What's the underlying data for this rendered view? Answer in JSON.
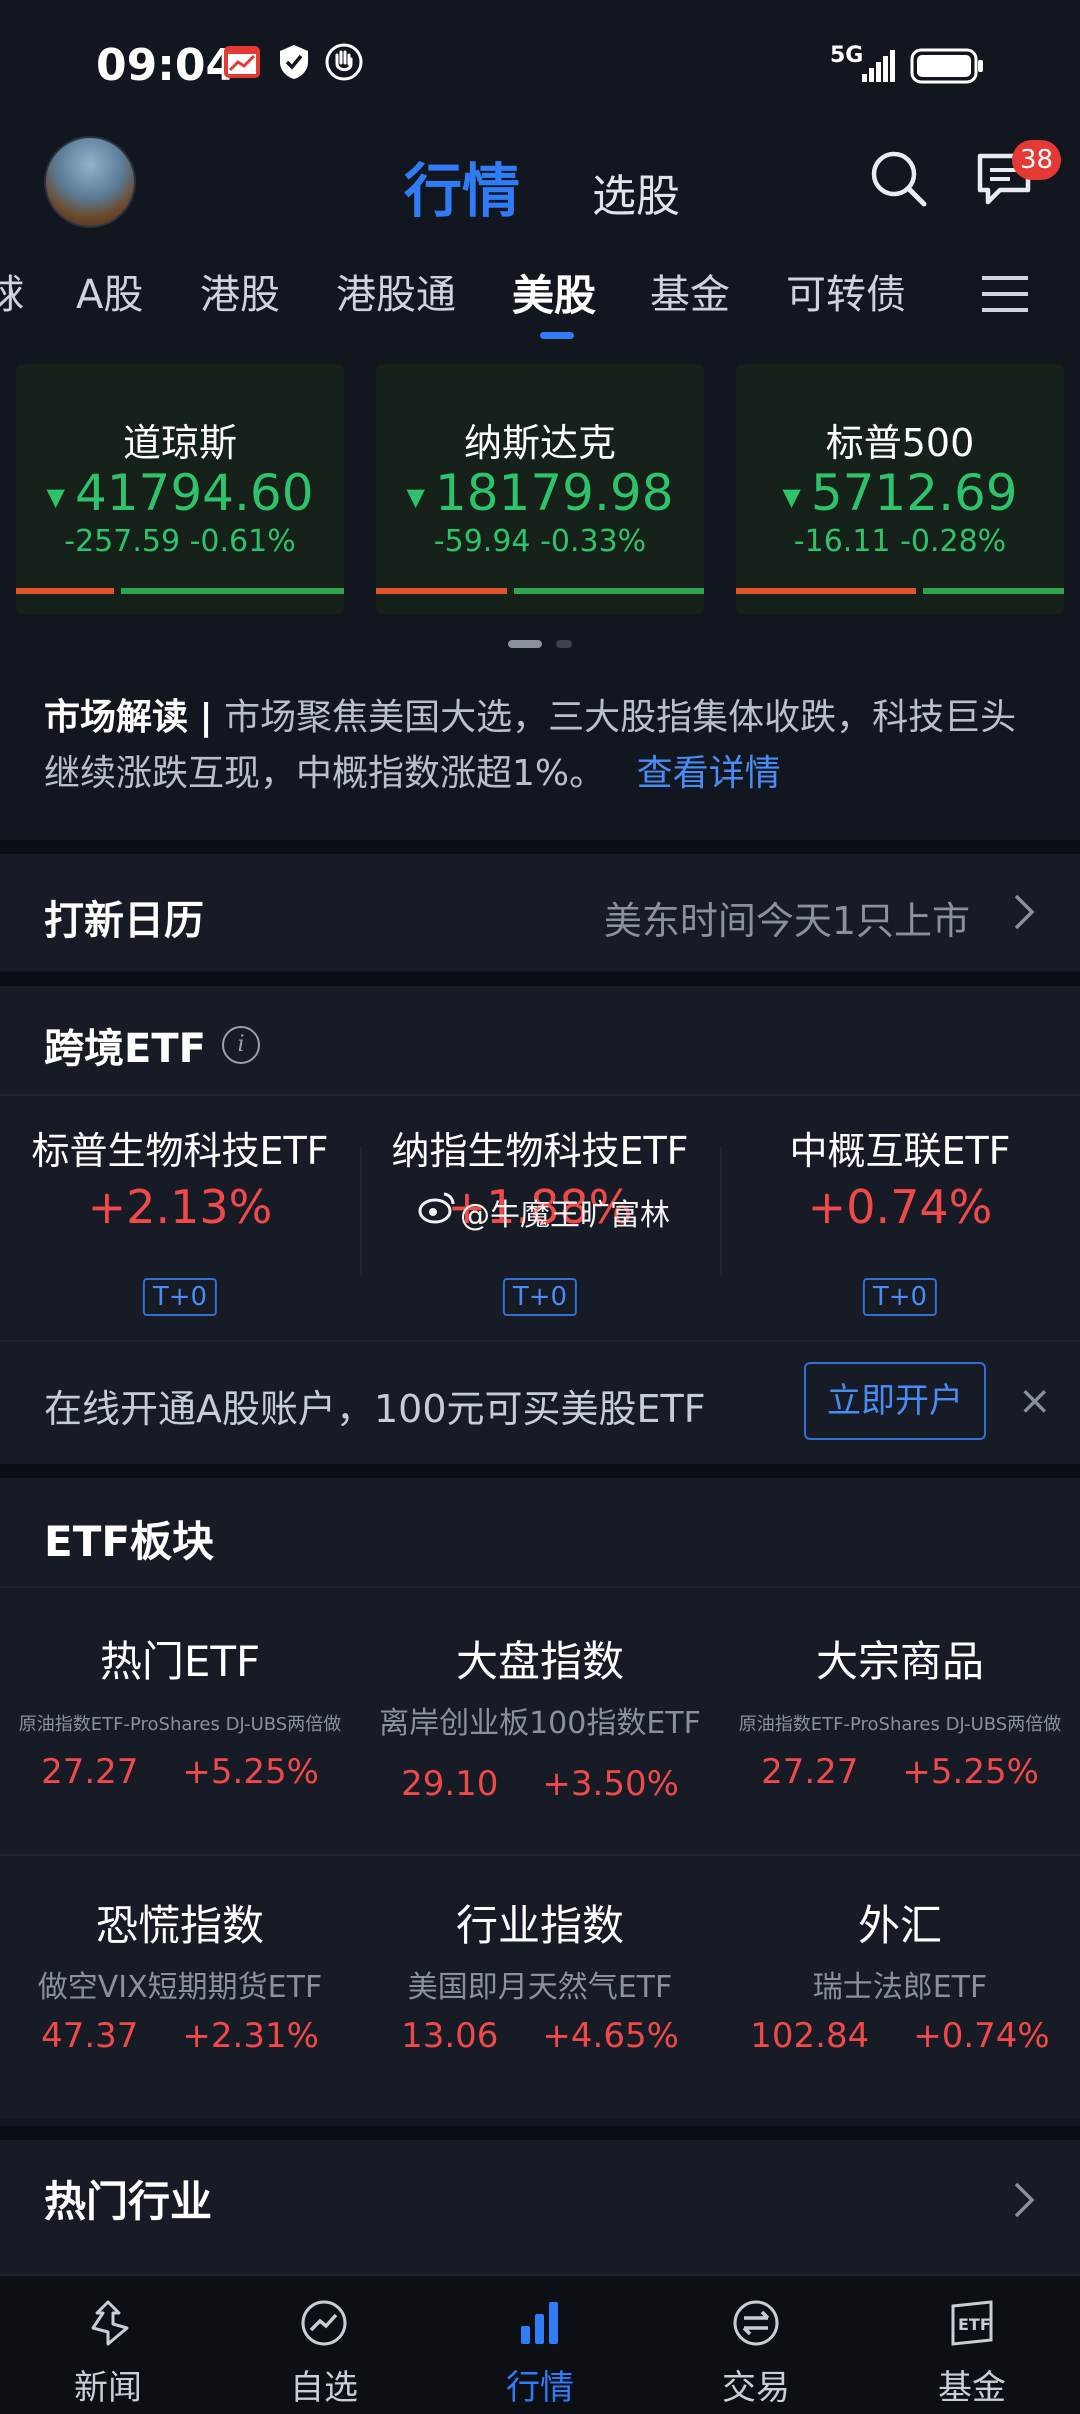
{
  "status_bar": {
    "time": "09:04",
    "network": "5G"
  },
  "header": {
    "title": "行情",
    "subtitle": "选股",
    "message_badge": "38"
  },
  "tabs": [
    "球",
    "A股",
    "港股",
    "港股通",
    "美股",
    "基金",
    "可转债"
  ],
  "active_tab": "美股",
  "indices": [
    {
      "name": "道琼斯",
      "value": "41794.60",
      "change": "-257.59",
      "percent": "-0.61%",
      "red_share": 0.3
    },
    {
      "name": "纳斯达克",
      "value": "18179.98",
      "change": "-59.94",
      "percent": "-0.33%",
      "red_share": 0.4
    },
    {
      "name": "标普500",
      "value": "5712.69",
      "change": "-16.11",
      "percent": "-0.28%",
      "red_share": 0.55
    }
  ],
  "market_read": {
    "label": "市场解读",
    "divider": "|",
    "text": "市场聚焦美国大选，三大股指集体收跌，科技巨头继续涨跌互现，中概指数涨超1%。",
    "link": "查看详情"
  },
  "ipo": {
    "title": "打新日历",
    "desc": "美东时间今天1只上市"
  },
  "cross_etf": {
    "title": "跨境ETF",
    "items": [
      {
        "name": "标普生物科技ETF",
        "pct": "+2.13%",
        "tag": "T+0"
      },
      {
        "name": "纳指生物科技ETF",
        "pct": "+1.88%",
        "tag": "T+0"
      },
      {
        "name": "中概互联ETF",
        "pct": "+0.74%",
        "tag": "T+0"
      }
    ]
  },
  "watermark": "@牛魔王旷富林",
  "promo": {
    "text": "在线开通A股账户，100元可买美股ETF",
    "button": "立即开户",
    "close": "×"
  },
  "sector": {
    "title": "ETF板块",
    "items": [
      {
        "name": "热门ETF",
        "desc": "原油指数ETF-ProShares DJ-UBS两倍做",
        "price": "27.27",
        "pct": "+5.25%"
      },
      {
        "name": "大盘指数",
        "desc": "离岸创业板100指数ETF",
        "price": "29.10",
        "pct": "+3.50%"
      },
      {
        "name": "大宗商品",
        "desc": "原油指数ETF-ProShares DJ-UBS两倍做",
        "price": "27.27",
        "pct": "+5.25%"
      },
      {
        "name": "恐慌指数",
        "desc": "做空VIX短期期货ETF",
        "price": "47.37",
        "pct": "+2.31%"
      },
      {
        "name": "行业指数",
        "desc": "美国即月天然气ETF",
        "price": "13.06",
        "pct": "+4.65%"
      },
      {
        "name": "外汇",
        "desc": "瑞士法郎ETF",
        "price": "102.84",
        "pct": "+0.74%"
      }
    ]
  },
  "hot_industry": {
    "title": "热门行业"
  },
  "bottom_nav": [
    "新闻",
    "自选",
    "行情",
    "交易",
    "基金"
  ],
  "colors": {
    "accent": "#2f7cf6",
    "up": "#f0494a",
    "down": "#2ec26a"
  }
}
